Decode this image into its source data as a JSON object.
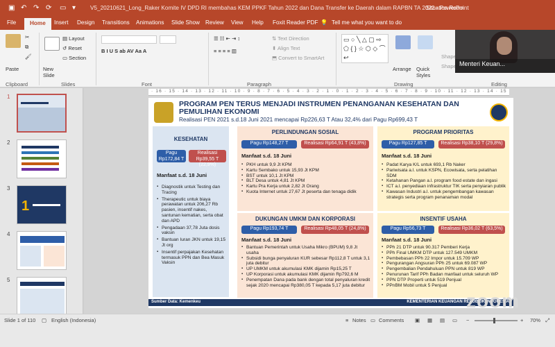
{
  "titlebar": {
    "quick_access": [
      "💾",
      "↶",
      "↷",
      "⟳",
      "⎙"
    ],
    "doc_title": "V5_20210621_Long_Raker Komite IV DPD RI membahas KEM PPKF Tahun 2022 dan Dana Transfer ke Daerah dalam RAPBN TA 2022  -  PowerPoint",
    "situation_room": "Situation Room"
  },
  "tabs": [
    "File",
    "Home",
    "Insert",
    "Design",
    "Transitions",
    "Animations",
    "Slide Show",
    "Review",
    "View",
    "Help",
    "Foxit Reader PDF",
    "Tell me what you want to do"
  ],
  "ribbon": {
    "paste": "Paste",
    "new_slide": "New Slide",
    "layout": "Layout",
    "reset": "Reset",
    "section": "Section",
    "text_direction": "Text Direction",
    "align_text": "Align Text",
    "smartart": "Convert to SmartArt",
    "arrange": "Arrange",
    "quick_styles": "Quick Styles",
    "shape_fill": "Shape",
    "shape_outline": "Shape",
    "groups": [
      "Clipboard",
      "Slides",
      "Font",
      "Paragraph",
      "Drawing",
      "Editing"
    ]
  },
  "webcam": {
    "name": "Menteri Keuan..."
  },
  "ruler": "· 16 · 15 · 14 · 13 · 12 · 11 · 10 · 9 · 8 · 7 · 6 · 5 · 4 · 3 · 2 · 1 · 0 · 1 · 2 · 3 · 4 · 5 · 6 · 7 · 8 · 9 · 10 · 11 · 12 · 13 · 14 · 15 · 16 ·",
  "thumbnails": [
    {
      "num": "1"
    },
    {
      "num": "2"
    },
    {
      "num": "3"
    },
    {
      "num": "4"
    },
    {
      "num": "5"
    }
  ],
  "slide": {
    "title": "PROGRAM PEN TERUS MENJADI INSTRUMEN PENANGANAN KESEHATAN DAN PEMULIHAN EKONOMI",
    "subtitle": "Realisasi PEN 2021 s.d.18 Juni 2021 mencapai Rp226,63 T Atau 32,4% dari Pagu Rp699,43 T",
    "kesehatan": {
      "head": "KESEHATAN",
      "pagu": "Pagu Rp172,84 T",
      "realisasi": "Realisasi Rp39,55 T (22,9%)",
      "manfaat": "Manfaat s.d. 18 Juni",
      "items": [
        "Diagnostik untuk Testing dan Tracing",
        "Therapeutic untuk biaya perawatan untuk  206,27 Rb pasien, insentif nakes, santunan  kematian, serta obat dan APD",
        "Pengadaan 37,78 Juta dosis vaksin",
        "Bantuan Iuran JKN untuk 19,15 Jt org",
        "Insentif perpajakan Kesehatan termasuk  PPN dan Bea Masuk Vaksin"
      ]
    },
    "perlinsos": {
      "head": "PERLINDUNGAN SOSIAL",
      "pagu": "Pagu Rp148,27 T",
      "realisasi": "Realisasi Rp64,91 T (43,8%)",
      "manfaat": "Manfaat s.d. 18 Juni",
      "items": [
        "PKH untuk 9,9 Jt KPM",
        "Kartu Sembako untuk 15,93 Jt KPM",
        "BST untuk 10,1 Jt KPM",
        "BLT Desa untuk 4,81 Jt KPM",
        "Kartu Pra Kerja untuk 2,82 Jt Orang",
        "Kuota Internet untuk 27,67 Jt  peserta dan tenaga didik"
      ]
    },
    "umkm": {
      "head": "DUKUNGAN UMKM DAN KORPORASI",
      "pagu": "Pagu Rp193,74 T",
      "realisasi": "Realisasi Rp48,05 T (24,8%)",
      "manfaat": "Manfaat s.d. 18 Juni",
      "items": [
        "Bantuan Pemerintah untuk Usaha Mikro (BPUM) 9,8 Jt usaha",
        "Subsidi bunga penyaluran KUR sebesar Rp112,8 T untuk 3,1 juta debitur",
        "UP UMKM untuk akumulasi KMK dijamin Rp15,25 T",
        "UP Korporasi untuk akumulasi KMK dijamin Rp792,6 M",
        "Penempatan Dana pada bank dengan total  penyaluran kredit sejak 2020 mencapai Rp380,05 T  kepada 5,17 juta debitur"
      ]
    },
    "prioritas": {
      "head": "PROGRAM PRIORITAS",
      "pagu": "Pagu Rp127,85 T",
      "realisasi": "Realisasi Rp38,10 T (29,8%)",
      "manfaat": "Manfaat s.d. 18 Juni",
      "items": [
        "Padat Karya K/L untuk 693,1 Rb Naker",
        "Pariwisata a.l. untuk KSPN, Ecowisata, serta  pelatihan SDM",
        "Ketahanan Pangan a.l. program food  estate dan ingasi",
        "ICT a.l. penyediaan  infrastruktur TIK serta penyiaran publik",
        "Kawasan Industri a.l. untuk pengembangan  kawasan strategis serta program  penanaman modal"
      ]
    },
    "insentif": {
      "head": "INSENTIF USAHA",
      "pagu": "Pagu Rp56,73 T",
      "realisasi": "Realisasi Rp36,02 T (63,5%)",
      "manfaat": "Manfaat s.d. 18 Juni",
      "items": [
        "PPh 21 DTP untuk 90.317 Pemberi Kerja",
        "PPh Final UMKM DTP untuk 127.549 UMKM",
        "Pembebasan PPh 22 Impor untuk 15.709 WP",
        "Pengurangan Angsuran PPh 25 untuk 69.087 WP",
        "Pengembalian Pendahuluan PPN untuk 819 WP",
        "Penurunan Tarif PPh Badan manfaat untuk seluruh WP",
        "PPN DTP Properti untuk 519 Penjual",
        "PPnBM Mobil untuk 5 Penjual"
      ]
    },
    "footer_left": "Sumber Data: Kemenkeu",
    "footer_right": "KEMENTERIAN KEUANGAN REPUBLIK INDONESIA"
  },
  "statusbar": {
    "slide": "Slide 1 of 110",
    "lang": "English (Indonesia)",
    "notes": "Notes",
    "comments": "Comments",
    "zoom": "70%"
  },
  "watermark": "zoom"
}
